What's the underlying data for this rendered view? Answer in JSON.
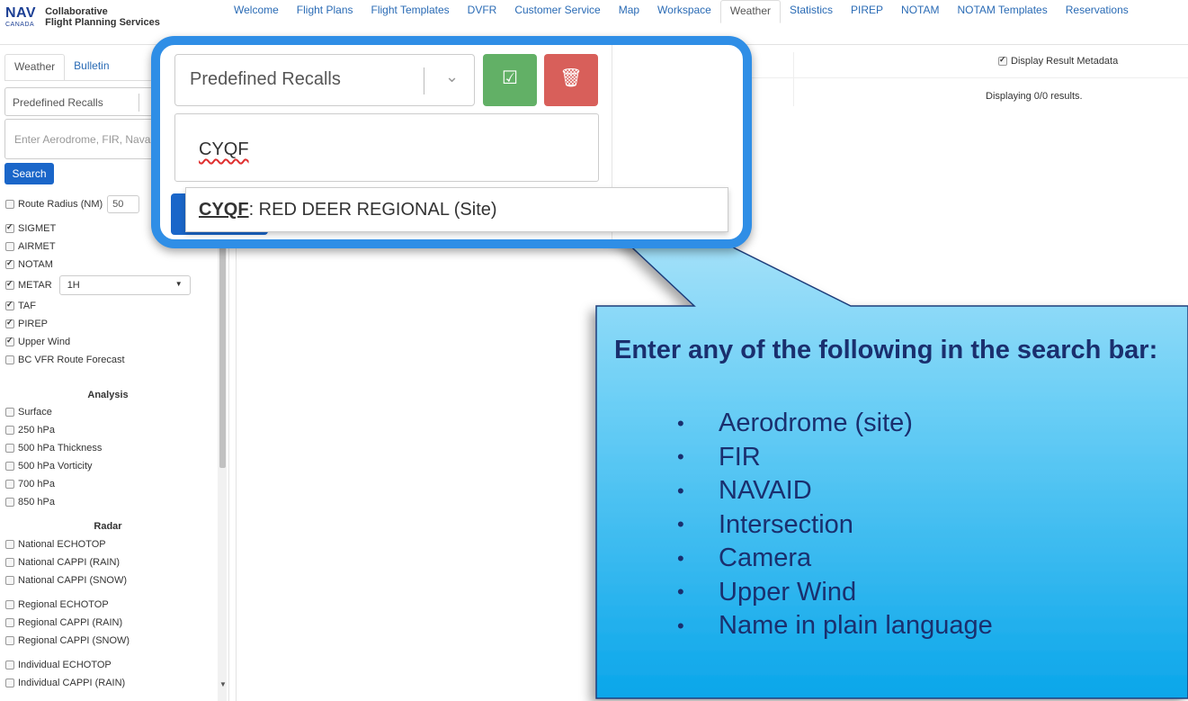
{
  "app": {
    "logo_main": "NAV",
    "logo_sub": "CANADA",
    "logo_text_1": "Collaborative",
    "logo_text_2": "Flight Planning Services"
  },
  "nav": {
    "tabs": [
      "Welcome",
      "Flight Plans",
      "Flight Templates",
      "DVFR",
      "Customer Service",
      "Map",
      "Workspace",
      "Weather",
      "Statistics",
      "PIREP",
      "NOTAM",
      "NOTAM Templates",
      "Reservations"
    ],
    "active": "Weather"
  },
  "sidebar": {
    "tabs": [
      "Weather",
      "Bulletin"
    ],
    "recall_placeholder": "Predefined Recalls",
    "search_placeholder": "Enter Aerodrome, FIR, Navai",
    "search_button": "Search",
    "route_radius_label": "Route Radius (NM)",
    "route_radius_value": "50",
    "metar_option": "1H",
    "products": [
      {
        "label": "SIGMET",
        "checked": true
      },
      {
        "label": "AIRMET",
        "checked": false
      },
      {
        "label": "NOTAM",
        "checked": true
      },
      {
        "label": "METAR",
        "checked": true
      },
      {
        "label": "TAF",
        "checked": true
      },
      {
        "label": "PIREP",
        "checked": true
      },
      {
        "label": "Upper Wind",
        "checked": true
      },
      {
        "label": "BC VFR Route Forecast",
        "checked": false
      }
    ],
    "analysis_title": "Analysis",
    "analysis": [
      "Surface",
      "250 hPa",
      "500 hPa Thickness",
      "500 hPa Vorticity",
      "700 hPa",
      "850 hPa"
    ],
    "radar_title": "Radar",
    "radar": [
      "National ECHOTOP",
      "National CAPPI (RAIN)",
      "National CAPPI (SNOW)",
      "Regional ECHOTOP",
      "Regional CAPPI (RAIN)",
      "Regional CAPPI (SNOW)",
      "Individual ECHOTOP",
      "Individual CAPPI (RAIN)"
    ]
  },
  "results": {
    "metadata_label": "Display Result Metadata",
    "metadata_checked": true,
    "count_text": "Displaying 0/0 results."
  },
  "zoom": {
    "recall_placeholder": "Predefined Recalls",
    "input_value": "CYQF",
    "suggestion_code": "CYQF",
    "suggestion_rest": ": RED DEER REGIONAL (Site)"
  },
  "callout": {
    "title": "Enter any of the following in the search bar:",
    "items": [
      "Aerodrome (site)",
      "FIR",
      "NAVAID",
      "Intersection",
      "Camera",
      "Upper Wind",
      "Name in plain language"
    ],
    "bullet": "•"
  },
  "colors": {
    "link": "#2a6bb5",
    "primary_button": "#1a66c9",
    "ok_button": "#62b066",
    "delete_button": "#d85f5a",
    "zoom_border": "#2f8ee6",
    "callout_text": "#1a2f6e"
  },
  "icons": {
    "ok": "check-square-icon",
    "delete": "trash-icon",
    "chevron": "chevron-down-icon"
  }
}
